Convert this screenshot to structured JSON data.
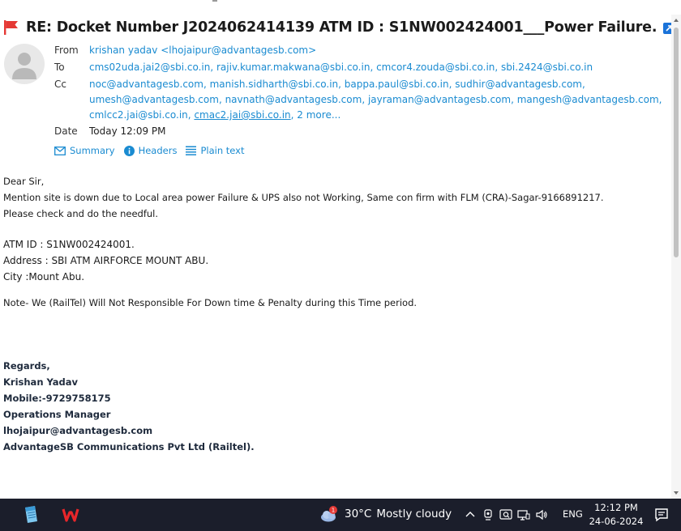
{
  "email": {
    "subject": "RE: Docket Number J2024062414139 ATM ID : S1NW002424001___Power Failure.",
    "labels": {
      "from": "From",
      "to": "To",
      "cc": "Cc",
      "date": "Date"
    },
    "from": "krishan yadav <lhojaipur@advantagesb.com>",
    "to": [
      "cms02uda.jai2@sbi.co.in",
      "rajiv.kumar.makwana@sbi.co.in",
      "cmcor4.zouda@sbi.co.in",
      "sbi.2424@sbi.co.in"
    ],
    "cc_line1": [
      "noc@advantagesb.com",
      "manish.sidharth@sbi.co.in",
      "bappa.paul@sbi.co.in",
      "sudhir@advantagesb.com,"
    ],
    "cc_line2": [
      "umesh@advantagesb.com",
      "navnath@advantagesb.com",
      "jayraman@advantagesb.com",
      "mangesh@advantagesb.com,"
    ],
    "cc_line3_a": "cmlcc2.jai@sbi.co.in,",
    "cc_line3_b": "cmac2.jai@sbi.co.in",
    "cc_more": "2 more...",
    "date": "Today 12:09 PM",
    "tabs": {
      "summary": "Summary",
      "headers": "Headers",
      "plain": "Plain text"
    },
    "body": {
      "greeting": "Dear Sir,",
      "line1": "Mention site is down due to Local area power Failure & UPS also not Working, Same con firm with FLM (CRA)-Sagar-9166891217.",
      "line2": "Please check and do the needful.",
      "atm": "ATM ID : S1NW002424001.",
      "address": "Address : SBI ATM AIRFORCE MOUNT ABU.",
      "city": "City :Mount Abu.",
      "note": "Note- We (RailTel) Will Not Responsible For Down time & Penalty during this Time period."
    },
    "signature": {
      "regards": "Regards,",
      "name": "Krishan Yadav",
      "mobile": "Mobile:-9729758175",
      "title": "Operations Manager",
      "email": "lhojaipur@advantagesb.com",
      "company": "AdvantageSB Communications Pvt Ltd (Railtel)."
    }
  },
  "taskbar": {
    "weather_temp": "30°C",
    "weather_cond": "Mostly cloudy",
    "weather_badge": "1",
    "lang": "ENG",
    "time": "12:12 PM",
    "date": "24-06-2024"
  },
  "colors": {
    "link": "#1a8bd1",
    "flag": "#e53935",
    "taskbar": "#1b1e2b"
  },
  "icons": [
    "flag-icon",
    "popout-icon",
    "avatar-icon",
    "summary-icon",
    "headers-icon",
    "plaintext-icon",
    "weather-icon",
    "notification-icon"
  ]
}
